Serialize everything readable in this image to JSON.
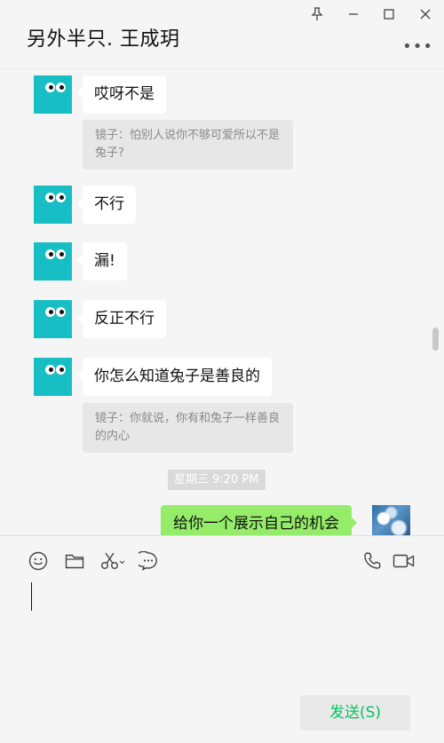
{
  "header": {
    "title": "另外半只. 王成玥",
    "more_label": "•••"
  },
  "window_controls": {
    "pin_icon": "pin-icon",
    "minimize_icon": "minimize-icon",
    "maximize_icon": "maximize-icon",
    "close_icon": "close-icon"
  },
  "messages": [
    {
      "text": "哎呀不是",
      "quote": "镜子：怕别人说你不够可爱所以不是兔子?"
    },
    {
      "text": "不行"
    },
    {
      "text": "漏!"
    },
    {
      "text": "反正不行"
    },
    {
      "text": "你怎么知道兔子是善良的",
      "quote": "镜子：你就说，你有和兔子一样善良的内心"
    }
  ],
  "time_divider": "星期三 9:20 PM",
  "my_message": "给你一个展示自己的机会",
  "toolbar": {
    "icons": [
      "emoji-icon",
      "folder-icon",
      "scissors-icon",
      "chat-bubble-icon",
      "phone-icon",
      "video-icon"
    ]
  },
  "send_button": "发送(S)",
  "colors": {
    "avatar": "#17bfc4",
    "my_bubble": "#95ec69",
    "send_text": "#07c160"
  }
}
